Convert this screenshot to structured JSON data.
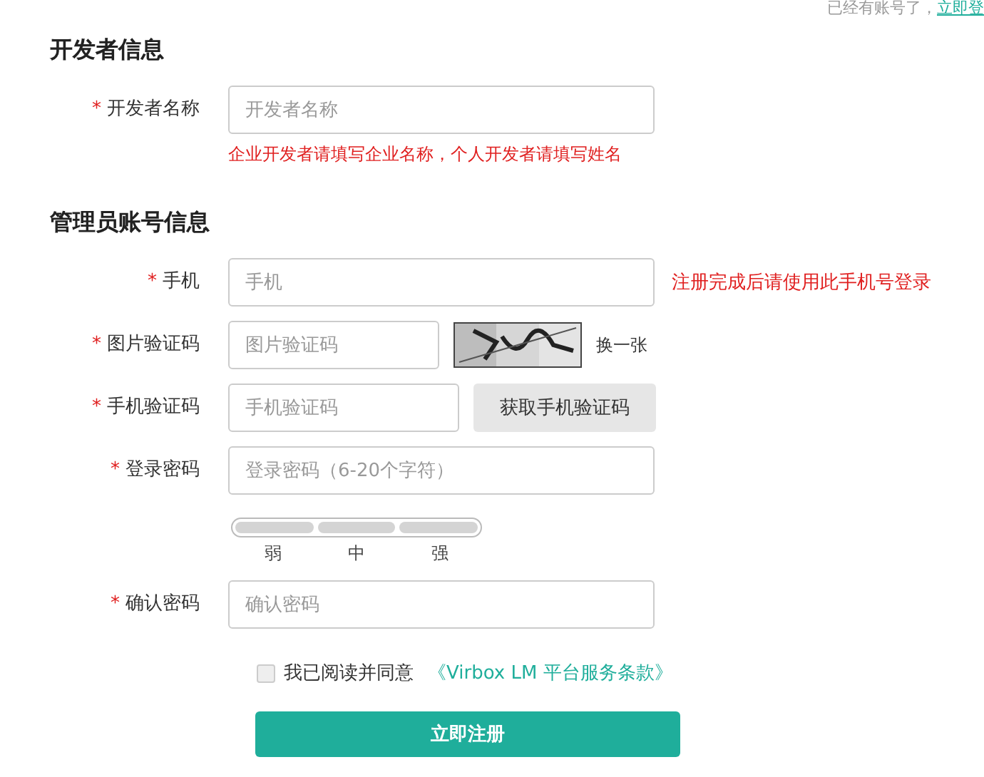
{
  "top_note": {
    "text": "已经有账号了，",
    "link": "立即登"
  },
  "sections": [
    {
      "title": "开发者信息",
      "fields": [
        {
          "kind": "text",
          "required_mark": "*",
          "label": "开发者名称",
          "placeholder": "开发者名称",
          "hint": "企业开发者请填写企业名称，个人开发者请填写姓名"
        }
      ]
    },
    {
      "title": "管理员账号信息",
      "fields": [
        {
          "kind": "text",
          "required_mark": "*",
          "label": "手机",
          "placeholder": "手机",
          "side_note": "注册完成后请使用此手机号登录"
        },
        {
          "kind": "captcha",
          "required_mark": "*",
          "label": "图片验证码",
          "placeholder": "图片验证码",
          "refresh": "换一张"
        },
        {
          "kind": "sms",
          "required_mark": "*",
          "label": "手机验证码",
          "placeholder": "手机验证码",
          "button": "获取手机验证码"
        },
        {
          "kind": "password",
          "required_mark": "*",
          "label": "登录密码",
          "placeholder": "登录密码（6-20个字符）",
          "strength": {
            "labels": [
              "弱",
              "中",
              "强"
            ]
          }
        },
        {
          "kind": "text",
          "required_mark": "*",
          "label": "确认密码",
          "placeholder": "确认密码"
        }
      ]
    }
  ],
  "agreement": {
    "checked": false,
    "text": "我已阅读并同意",
    "link": "《Virbox LM 平台服务条款》"
  },
  "submit": "立即注册"
}
